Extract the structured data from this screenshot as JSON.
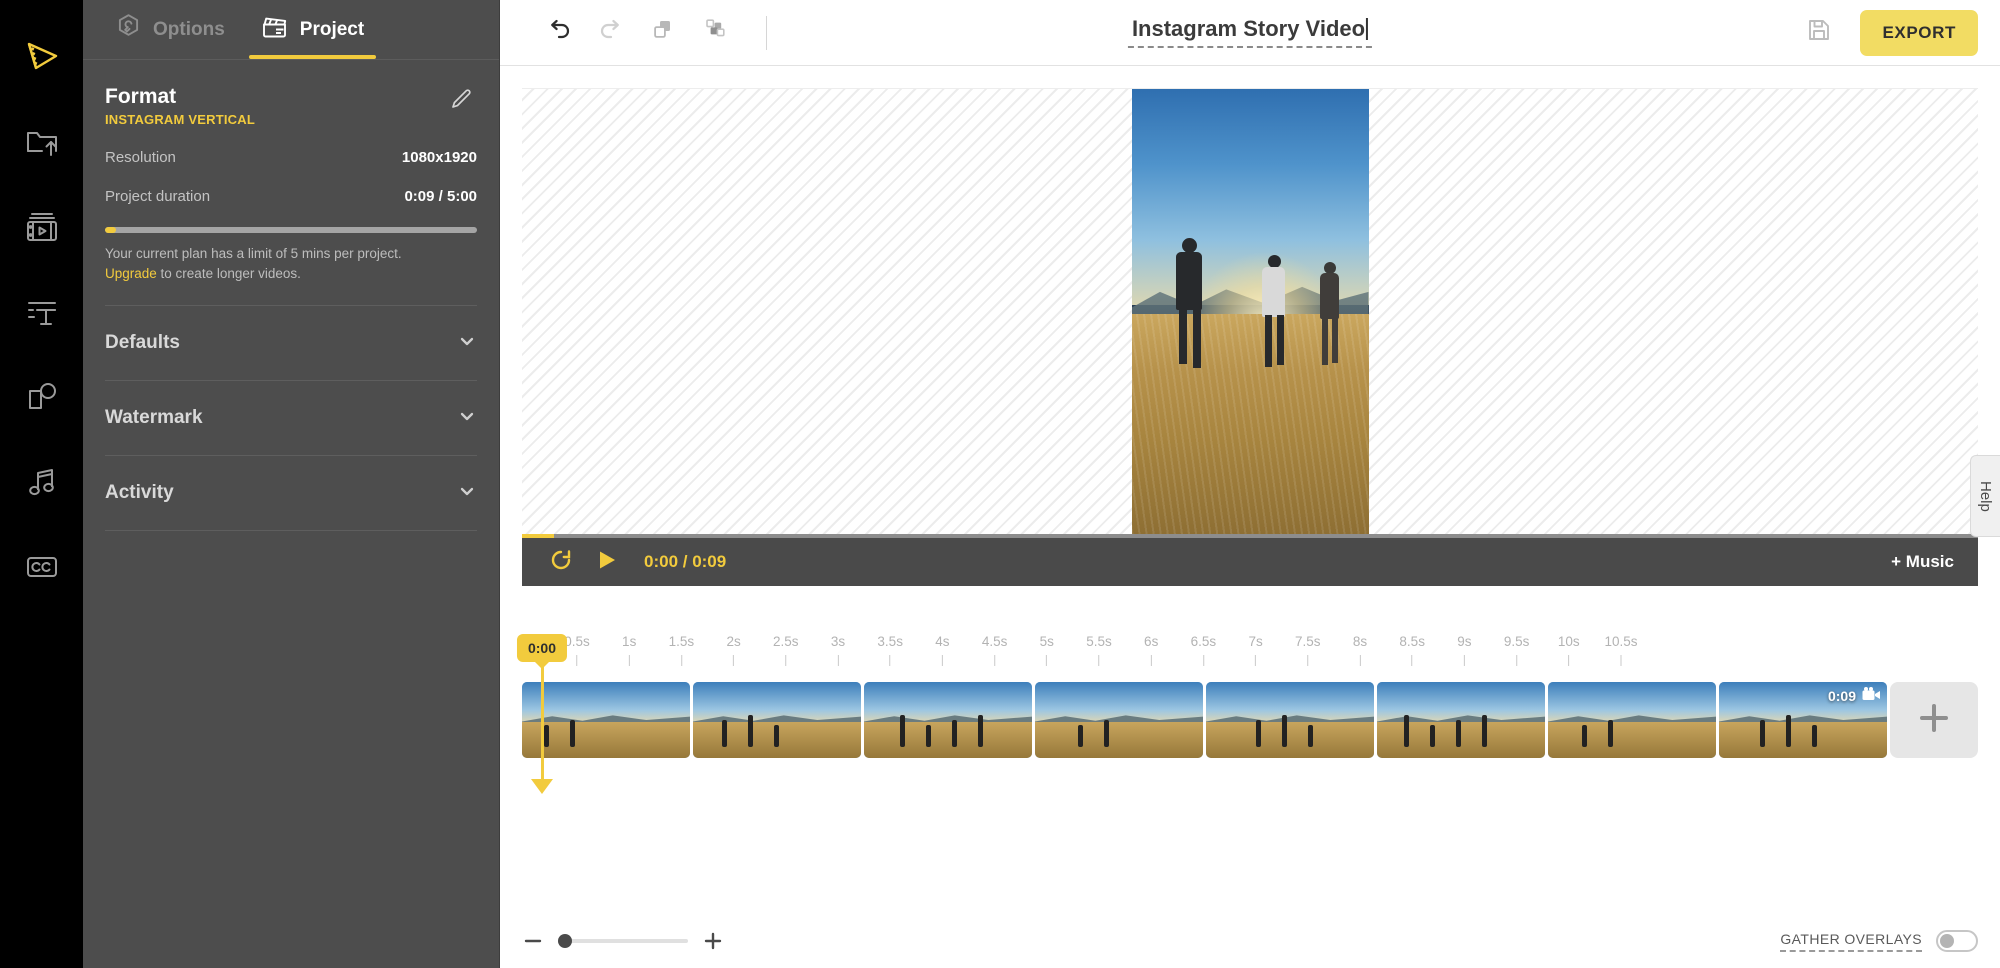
{
  "rail": {
    "items": [
      {
        "name": "logo-icon",
        "label": "Animoto logo"
      },
      {
        "name": "folder-upload-icon",
        "label": "Upload media"
      },
      {
        "name": "video-library-icon",
        "label": "Stock video"
      },
      {
        "name": "text-block-icon",
        "label": "Text"
      },
      {
        "name": "shapes-icon",
        "label": "Design"
      },
      {
        "name": "music-note-icon",
        "label": "Music"
      },
      {
        "name": "closed-captions-icon",
        "label": "Captions"
      }
    ]
  },
  "panel": {
    "tabs": [
      {
        "id": "options",
        "label": "Options",
        "active": false
      },
      {
        "id": "project",
        "label": "Project",
        "active": true
      }
    ],
    "format": {
      "title": "Format",
      "subtitle": "INSTAGRAM VERTICAL",
      "edit_tooltip": "Edit format"
    },
    "rows": [
      {
        "key": "Resolution",
        "value": "1080x1920"
      },
      {
        "key": "Project duration",
        "value": "0:09 / 5:00"
      }
    ],
    "progress_percent": 3,
    "note_text_1": "Your current plan has a limit of 5 mins per project.",
    "note_link": "Upgrade",
    "note_text_2": " to create longer videos.",
    "accordions": [
      {
        "label": "Defaults"
      },
      {
        "label": "Watermark"
      },
      {
        "label": "Activity"
      }
    ]
  },
  "topbar": {
    "undo_label": "Undo",
    "redo_label": "Redo",
    "duplicate_label": "Duplicate",
    "arrange_label": "Arrange",
    "title": "Instagram Story Video",
    "save_label": "Save",
    "export_label": "EXPORT"
  },
  "player": {
    "loop_label": "Loop",
    "play_label": "Play",
    "current_time": "0:00",
    "total_time": "0:09",
    "time_display": "0:00 / 0:09",
    "add_music_label": "+ Music",
    "progress_percent": 2.2
  },
  "timeline": {
    "playhead_label": "0:00",
    "ticks": [
      "0.5s",
      "1s",
      "1.5s",
      "2s",
      "2.5s",
      "3s",
      "3.5s",
      "4s",
      "4.5s",
      "5s",
      "5.5s",
      "6s",
      "6.5s",
      "7s",
      "7.5s",
      "8s",
      "8.5s",
      "9s",
      "9.5s",
      "10s",
      "10.5s"
    ],
    "clips": [
      {
        "id": 1
      },
      {
        "id": 2
      },
      {
        "id": 3
      },
      {
        "id": 4
      },
      {
        "id": 5
      },
      {
        "id": 6
      },
      {
        "id": 7
      },
      {
        "id": 8
      }
    ],
    "clip_duration_badge": "0:09",
    "add_clip_label": "+",
    "zoom_out_label": "−",
    "zoom_in_label": "+",
    "zoom_value": 0,
    "gather_overlays_label": "GATHER OVERLAYS",
    "gather_overlays_on": false
  },
  "help": {
    "label": "Help"
  },
  "colors": {
    "accent": "#f2cb3d",
    "export_bg": "#f2dc63",
    "panel_bg": "#4d4d4d",
    "rail_bg": "#000000"
  }
}
